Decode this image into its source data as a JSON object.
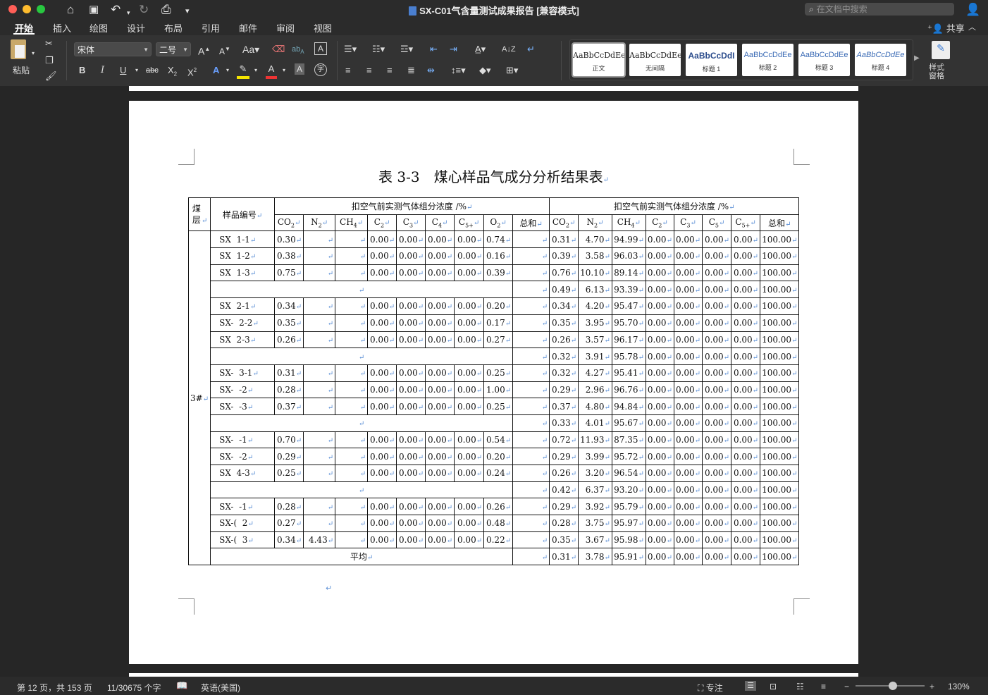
{
  "window": {
    "title": "SX-C01气含量测试成果报告 [兼容模式]",
    "search_placeholder": "在文档中搜索"
  },
  "tabs": [
    "开始",
    "插入",
    "绘图",
    "设计",
    "布局",
    "引用",
    "邮件",
    "审阅",
    "视图"
  ],
  "share_label": "共享",
  "ribbon": {
    "paste_label": "粘贴",
    "font_name": "宋体",
    "font_size": "二号",
    "style_pane_label": "样式\n窗格",
    "styles": [
      {
        "preview": "AaBbCcDdEe",
        "name": "正文"
      },
      {
        "preview": "AaBbCcDdEe",
        "name": "无间隔"
      },
      {
        "preview": "AaBbCcDdI",
        "name": "标题 1"
      },
      {
        "preview": "AaBbCcDdEe",
        "name": "标题 2"
      },
      {
        "preview": "AaBbCcDdEe",
        "name": "标题 3"
      },
      {
        "preview": "AaBbCcDdEe",
        "name": "标题 4"
      }
    ]
  },
  "document": {
    "table_title": "表 3-3　煤心样品气成分分析结果表",
    "header": {
      "seam": "煤层",
      "sample_id": "样品编号",
      "group_before": "扣空气前实测气体组分浓度 /%",
      "group_after": "扣空气前实测气体组分浓度 /%",
      "avg_label": "平均",
      "seam_value": "3#"
    },
    "rows": [
      {
        "id": "SX  1-1",
        "b": [
          "0.30",
          "",
          "",
          "0.00",
          "0.00",
          "0.00",
          "0.00",
          "0.74",
          ""
        ],
        "a": [
          "0.31",
          "4.70",
          "94.99",
          "0.00",
          "0.00",
          "0.00",
          "0.00",
          "100.00"
        ]
      },
      {
        "id": "SX  1-2",
        "b": [
          "0.38",
          "",
          "",
          "0.00",
          "0.00",
          "0.00",
          "0.00",
          "0.16",
          ""
        ],
        "a": [
          "0.39",
          "3.58",
          "96.03",
          "0.00",
          "0.00",
          "0.00",
          "0.00",
          "100.00"
        ]
      },
      {
        "id": "SX  1-3",
        "b": [
          "0.75",
          "",
          "",
          "0.00",
          "0.00",
          "0.00",
          "0.00",
          "0.39",
          ""
        ],
        "a": [
          "0.76",
          "10.10",
          "89.14",
          "0.00",
          "0.00",
          "0.00",
          "0.00",
          "100.00"
        ]
      },
      {
        "avg": true,
        "a": [
          "0.49",
          "6.13",
          "93.39",
          "0.00",
          "0.00",
          "0.00",
          "0.00",
          "100.00"
        ]
      },
      {
        "id": "SX  2-1",
        "b": [
          "0.34",
          "",
          "",
          "0.00",
          "0.00",
          "0.00",
          "0.00",
          "0.20",
          ""
        ],
        "a": [
          "0.34",
          "4.20",
          "95.47",
          "0.00",
          "0.00",
          "0.00",
          "0.00",
          "100.00"
        ]
      },
      {
        "id": "SX-  2-2",
        "b": [
          "0.35",
          "",
          "",
          "0.00",
          "0.00",
          "0.00",
          "0.00",
          "0.17",
          ""
        ],
        "a": [
          "0.35",
          "3.95",
          "95.70",
          "0.00",
          "0.00",
          "0.00",
          "0.00",
          "100.00"
        ]
      },
      {
        "id": "SX  2-3",
        "b": [
          "0.26",
          "",
          "",
          "0.00",
          "0.00",
          "0.00",
          "0.00",
          "0.27",
          ""
        ],
        "a": [
          "0.26",
          "3.57",
          "96.17",
          "0.00",
          "0.00",
          "0.00",
          "0.00",
          "100.00"
        ]
      },
      {
        "avg": true,
        "a": [
          "0.32",
          "3.91",
          "95.78",
          "0.00",
          "0.00",
          "0.00",
          "0.00",
          "100.00"
        ]
      },
      {
        "id": "SX-  3-1",
        "b": [
          "0.31",
          "",
          "",
          "0.00",
          "0.00",
          "0.00",
          "0.00",
          "0.25",
          ""
        ],
        "a": [
          "0.32",
          "4.27",
          "95.41",
          "0.00",
          "0.00",
          "0.00",
          "0.00",
          "100.00"
        ]
      },
      {
        "id": "SX-  -2",
        "b": [
          "0.28",
          "",
          "",
          "0.00",
          "0.00",
          "0.00",
          "0.00",
          "1.00",
          ""
        ],
        "a": [
          "0.29",
          "2.96",
          "96.76",
          "0.00",
          "0.00",
          "0.00",
          "0.00",
          "100.00"
        ]
      },
      {
        "id": "SX-  -3",
        "b": [
          "0.37",
          "",
          "",
          "0.00",
          "0.00",
          "0.00",
          "0.00",
          "0.25",
          ""
        ],
        "a": [
          "0.37",
          "4.80",
          "94.84",
          "0.00",
          "0.00",
          "0.00",
          "0.00",
          "100.00"
        ]
      },
      {
        "avg": true,
        "a": [
          "0.33",
          "4.01",
          "95.67",
          "0.00",
          "0.00",
          "0.00",
          "0.00",
          "100.00"
        ]
      },
      {
        "id": "SX-  -1",
        "b": [
          "0.70",
          "",
          "",
          "0.00",
          "0.00",
          "0.00",
          "0.00",
          "0.54",
          ""
        ],
        "a": [
          "0.72",
          "11.93",
          "87.35",
          "0.00",
          "0.00",
          "0.00",
          "0.00",
          "100.00"
        ]
      },
      {
        "id": "SX-  -2",
        "b": [
          "0.29",
          "",
          "",
          "0.00",
          "0.00",
          "0.00",
          "0.00",
          "0.20",
          ""
        ],
        "a": [
          "0.29",
          "3.99",
          "95.72",
          "0.00",
          "0.00",
          "0.00",
          "0.00",
          "100.00"
        ]
      },
      {
        "id": "SX  4-3",
        "b": [
          "0.25",
          "",
          "",
          "0.00",
          "0.00",
          "0.00",
          "0.00",
          "0.24",
          ""
        ],
        "a": [
          "0.26",
          "3.20",
          "96.54",
          "0.00",
          "0.00",
          "0.00",
          "0.00",
          "100.00"
        ]
      },
      {
        "avg": true,
        "a": [
          "0.42",
          "6.37",
          "93.20",
          "0.00",
          "0.00",
          "0.00",
          "0.00",
          "100.00"
        ]
      },
      {
        "id": "SX-  -1",
        "b": [
          "0.28",
          "",
          "",
          "0.00",
          "0.00",
          "0.00",
          "0.00",
          "0.26",
          ""
        ],
        "a": [
          "0.29",
          "3.92",
          "95.79",
          "0.00",
          "0.00",
          "0.00",
          "0.00",
          "100.00"
        ]
      },
      {
        "id": "SX-(  2",
        "b": [
          "0.27",
          "",
          "",
          "0.00",
          "0.00",
          "0.00",
          "0.00",
          "0.48",
          ""
        ],
        "a": [
          "0.28",
          "3.75",
          "95.97",
          "0.00",
          "0.00",
          "0.00",
          "0.00",
          "100.00"
        ]
      },
      {
        "id": "SX-(  3",
        "b": [
          "0.34",
          "4.43",
          "",
          "0.00",
          "0.00",
          "0.00",
          "0.00",
          "0.22",
          ""
        ],
        "a": [
          "0.35",
          "3.67",
          "95.98",
          "0.00",
          "0.00",
          "0.00",
          "0.00",
          "100.00"
        ]
      },
      {
        "avg": true,
        "avg_text": "平均",
        "a": [
          "0.31",
          "3.78",
          "95.91",
          "0.00",
          "0.00",
          "0.00",
          "0.00",
          "100.00"
        ]
      }
    ]
  },
  "status": {
    "page": "第 12 页，共 153 页",
    "words": "11/30675 个字",
    "language": "英语(美国)",
    "focus": "专注",
    "zoom": "130%"
  }
}
